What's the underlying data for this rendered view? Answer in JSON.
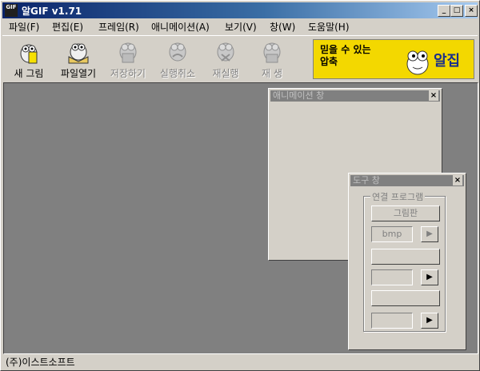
{
  "window": {
    "title": "알GIF v1.71",
    "app_icon": "GIF",
    "controls": {
      "minimize": "_",
      "maximize": "□",
      "close": "×"
    }
  },
  "menu": [
    {
      "label": "파일(F)"
    },
    {
      "label": "편집(E)"
    },
    {
      "label": "프레임(R)"
    },
    {
      "label": "애니메이션(A)"
    },
    {
      "label": "보기(V)"
    },
    {
      "label": "창(W)"
    },
    {
      "label": "도움말(H)"
    }
  ],
  "toolbar": [
    {
      "label": "새 그림",
      "icon": "new-picture-icon",
      "enabled": true
    },
    {
      "label": "파일열기",
      "icon": "open-file-icon",
      "enabled": true
    },
    {
      "label": "저장하기",
      "icon": "save-icon",
      "enabled": false
    },
    {
      "label": "실행취소",
      "icon": "undo-icon",
      "enabled": false
    },
    {
      "label": "재실행",
      "icon": "redo-icon",
      "enabled": false
    },
    {
      "label": "재  생",
      "icon": "play-icon",
      "enabled": false
    }
  ],
  "banner": {
    "line1": "믿을 수 있는",
    "line2": "압축",
    "logo": "알집"
  },
  "animation_window": {
    "title": "애니메이션 창",
    "close": "×"
  },
  "tool_window": {
    "title": "도구 창",
    "close": "×",
    "group_label": "연결 프로그램",
    "paint_button": "그림판",
    "format_field": "bmp",
    "arrow": "▶"
  },
  "status": {
    "text": "(주)이스트소프트"
  },
  "colors": {
    "title_start": "#0a246a",
    "title_end": "#a6caf0",
    "workspace": "#808080",
    "banner": "#f3d800"
  }
}
